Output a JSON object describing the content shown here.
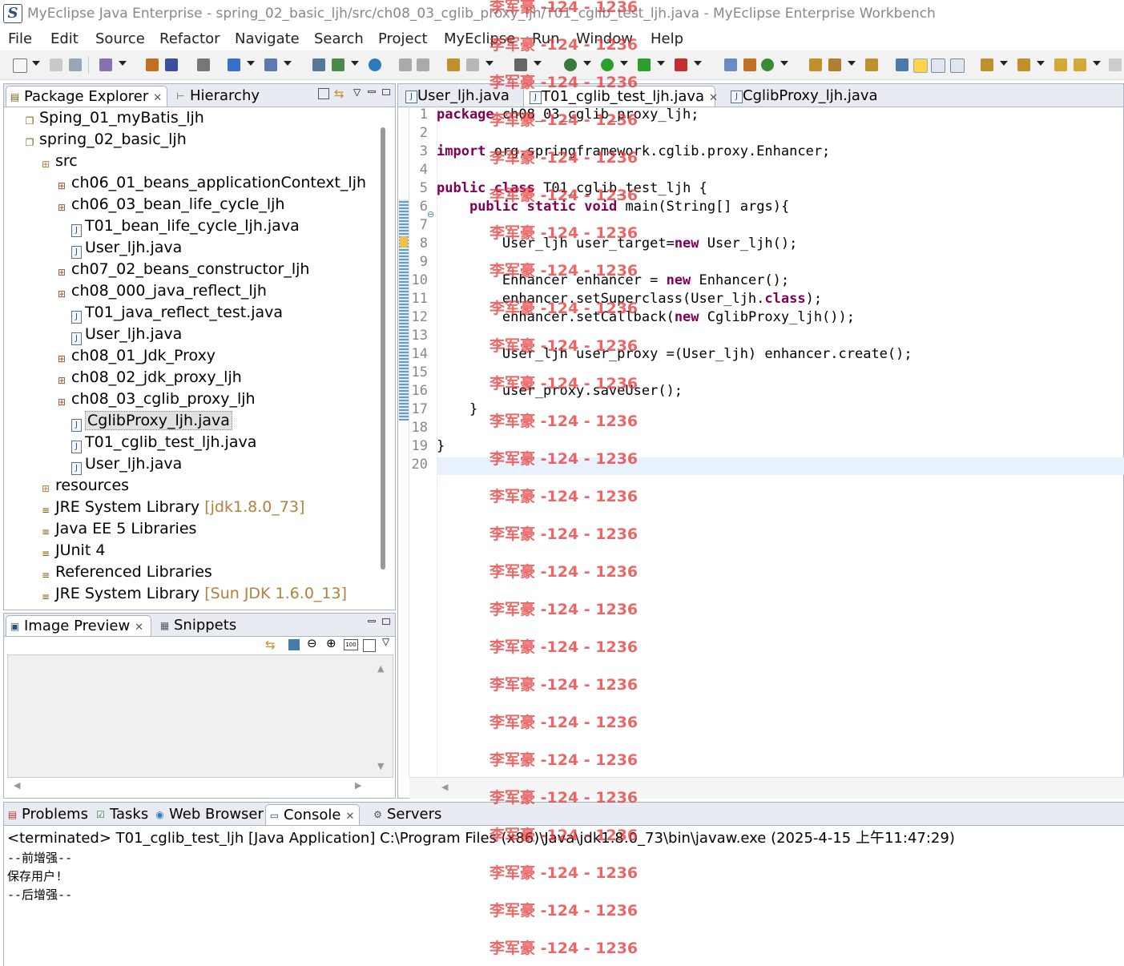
{
  "window": {
    "title": "MyEclipse Java Enterprise - spring_02_basic_ljh/src/ch08_03_cglib_proxy_ljh/T01_cglib_test_ljh.java - MyEclipse Enterprise Workbench"
  },
  "menu": [
    "File",
    "Edit",
    "Source",
    "Refactor",
    "Navigate",
    "Search",
    "Project",
    "MyEclipse",
    "Run",
    "Window",
    "Help"
  ],
  "explorer": {
    "tabs": [
      "Package Explorer",
      "Hierarchy"
    ],
    "tree": [
      {
        "label": "Sping_01_myBatis_ljh",
        "icon": "project-icon"
      },
      {
        "label": "spring_02_basic_ljh",
        "icon": "project-icon"
      },
      {
        "label": "src",
        "icon": "source-folder-icon"
      },
      {
        "label": "ch06_01_beans_applicationContext_ljh",
        "icon": "package-icon"
      },
      {
        "label": "ch06_03_bean_life_cycle_ljh",
        "icon": "package-icon"
      },
      {
        "label": "T01_bean_life_cycle_ljh.java",
        "icon": "java-file-icon"
      },
      {
        "label": "User_ljh.java",
        "icon": "java-file-icon"
      },
      {
        "label": "ch07_02_beans_constructor_ljh",
        "icon": "package-icon"
      },
      {
        "label": "ch08_000_java_reflect_ljh",
        "icon": "package-icon"
      },
      {
        "label": "T01_java_reflect_test.java",
        "icon": "java-file-icon"
      },
      {
        "label": "User_ljh.java",
        "icon": "java-file-icon"
      },
      {
        "label": "ch08_01_Jdk_Proxy",
        "icon": "package-icon"
      },
      {
        "label": "ch08_02_jdk_proxy_ljh",
        "icon": "package-icon"
      },
      {
        "label": "ch08_03_cglib_proxy_ljh",
        "icon": "package-icon"
      },
      {
        "label": "CglibProxy_ljh.java",
        "icon": "java-file-icon",
        "selected": true
      },
      {
        "label": "T01_cglib_test_ljh.java",
        "icon": "java-file-icon"
      },
      {
        "label": "User_ljh.java",
        "icon": "java-file-icon"
      },
      {
        "label": "resources",
        "icon": "folder-icon"
      },
      {
        "label": "JRE System Library",
        "icon": "library-icon",
        "decoration": "[jdk1.8.0_73]"
      },
      {
        "label": "Java EE 5 Libraries",
        "icon": "library-icon"
      },
      {
        "label": "JUnit 4",
        "icon": "library-icon"
      },
      {
        "label": "Referenced Libraries",
        "icon": "library-icon"
      },
      {
        "label": "JRE System Library",
        "icon": "library-icon",
        "decoration": "[Sun JDK 1.6.0_13]"
      }
    ]
  },
  "preview": {
    "tabs": [
      "Image Preview",
      "Snippets"
    ]
  },
  "editor": {
    "tabs": [
      "User_ljh.java",
      "T01_cglib_test_ljh.java",
      "CglibProxy_ljh.java"
    ],
    "active_tab": 1,
    "lines": [
      "package ch08_03_cglib_proxy_ljh;",
      "",
      "import org.springframework.cglib.proxy.Enhancer;",
      "",
      "public class T01_cglib_test_ljh {",
      "    public static void main(String[] args){",
      "",
      "        User_ljh user_target=new User_ljh();",
      "",
      "        Enhancer enhancer = new Enhancer();",
      "        enhancer.setSuperclass(User_ljh.class);",
      "        enhancer.setCallback(new CglibProxy_ljh());",
      "",
      "        User_ljh user_proxy =(User_ljh) enhancer.create();",
      "",
      "        user_proxy.saveUser();",
      "    }",
      "",
      "}",
      ""
    ]
  },
  "console": {
    "tabs": [
      "Problems",
      "Tasks",
      "Web Browser",
      "Console",
      "Servers"
    ],
    "header": "<terminated> T01_cglib_test_ljh [Java Application] C:\\Program Files (x86)\\Java\\jdk1.8.0_73\\bin\\javaw.exe (2025-4-15 上午11:47:29)",
    "output": [
      "--前增强--",
      "保存用户!",
      "--后增强--"
    ]
  },
  "watermark": "李军豪 -124 - 1236",
  "colors": {
    "keyword": "#7f0055",
    "watermark": "#e63c3c",
    "decoration": "#b08040"
  }
}
